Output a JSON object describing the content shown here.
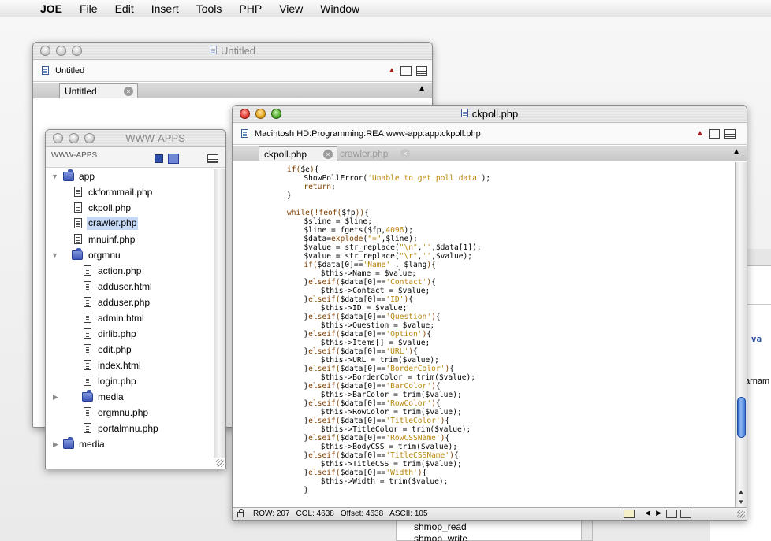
{
  "menubar": {
    "apple_glyph": "",
    "items": [
      "JOE",
      "File",
      "Edit",
      "Insert",
      "Tools",
      "PHP",
      "View",
      "Window"
    ]
  },
  "icons": {
    "apple": "apple-logo-icon",
    "document": "document-icon",
    "share": "share-icon",
    "split": "split-view-icon",
    "info": "info-panel-icon",
    "close_tab": "close-tab-icon",
    "disclosure_open": "disclosure-triangle-open-icon",
    "disclosure_closed": "disclosure-triangle-closed-icon",
    "folder": "folder-icon",
    "file": "file-icon",
    "save": "save-icon",
    "lock": "lock-icon"
  },
  "untitled_window": {
    "title": "Untitled",
    "path": "Untitled",
    "tabs": [
      {
        "label": "Untitled",
        "active": true
      }
    ]
  },
  "wwwapps_window": {
    "title": "WWW-APPS",
    "header": "WWW-APPS",
    "tree": [
      {
        "label": "app",
        "kind": "folder",
        "open": true,
        "depth": 0
      },
      {
        "label": "ckformmail.php",
        "kind": "file",
        "depth": 1
      },
      {
        "label": "ckpoll.php",
        "kind": "file",
        "depth": 1
      },
      {
        "label": "crawler.php",
        "kind": "file",
        "depth": 1,
        "selected": true
      },
      {
        "label": "mnuinf.php",
        "kind": "file",
        "depth": 1
      },
      {
        "label": "orgmnu",
        "kind": "folder",
        "open": true,
        "depth": 1
      },
      {
        "label": "action.php",
        "kind": "file",
        "depth": 2
      },
      {
        "label": "adduser.html",
        "kind": "file",
        "depth": 2
      },
      {
        "label": "adduser.php",
        "kind": "file",
        "depth": 2
      },
      {
        "label": "admin.html",
        "kind": "file",
        "depth": 2
      },
      {
        "label": "dirlib.php",
        "kind": "file",
        "depth": 2
      },
      {
        "label": "edit.php",
        "kind": "file",
        "depth": 2
      },
      {
        "label": "index.html",
        "kind": "file",
        "depth": 2
      },
      {
        "label": "login.php",
        "kind": "file",
        "depth": 2
      },
      {
        "label": "media",
        "kind": "folder",
        "open": false,
        "depth": 2
      },
      {
        "label": "orgmnu.php",
        "kind": "file",
        "depth": 2
      },
      {
        "label": "portalmnu.php",
        "kind": "file",
        "depth": 2
      },
      {
        "label": "media",
        "kind": "folder",
        "open": false,
        "depth": 0
      }
    ]
  },
  "editor_window": {
    "title": "ckpoll.php",
    "path": "Macintosh HD:Programming:REA:www-app:app:ckpoll.php",
    "tabs": [
      {
        "label": "ckpoll.php",
        "active": true
      },
      {
        "label": "crawler.php",
        "active": false
      }
    ],
    "code_lines": [
      [
        8,
        [
          [
            "k",
            "if("
          ],
          [
            "v",
            "$e"
          ],
          [
            "k",
            ")"
          ],
          [
            "n",
            "{"
          ]
        ]
      ],
      [
        12,
        [
          [
            "n",
            "ShowPollError("
          ],
          [
            "s",
            "'Unable to get poll data'"
          ],
          [
            "n",
            ");"
          ]
        ]
      ],
      [
        12,
        [
          [
            "k",
            "return"
          ],
          [
            "n",
            ";"
          ]
        ]
      ],
      [
        8,
        [
          [
            "n",
            "}"
          ]
        ]
      ],
      [
        0,
        []
      ],
      [
        8,
        [
          [
            "k",
            "while(!feof("
          ],
          [
            "v",
            "$fp"
          ],
          [
            "k",
            "))"
          ],
          [
            "n",
            "{"
          ]
        ]
      ],
      [
        12,
        [
          [
            "v",
            "$sline"
          ],
          [
            "n",
            " = "
          ],
          [
            "v",
            "$line"
          ],
          [
            "n",
            ";"
          ]
        ]
      ],
      [
        12,
        [
          [
            "v",
            "$line"
          ],
          [
            "n",
            " = fgets("
          ],
          [
            "v",
            "$fp"
          ],
          [
            "n",
            ","
          ],
          [
            "s",
            "4096"
          ],
          [
            "n",
            ");"
          ]
        ]
      ],
      [
        12,
        [
          [
            "v",
            "$data"
          ],
          [
            "n",
            "="
          ],
          [
            "k",
            "explode"
          ],
          [
            "n",
            "("
          ],
          [
            "s",
            "\"=\""
          ],
          [
            "n",
            ","
          ],
          [
            "v",
            "$line"
          ],
          [
            "n",
            ");"
          ]
        ]
      ],
      [
        12,
        [
          [
            "v",
            "$value"
          ],
          [
            "n",
            " = str_replace("
          ],
          [
            "s",
            "\"\\n\""
          ],
          [
            "n",
            ","
          ],
          [
            "s",
            "''"
          ],
          [
            "n",
            ","
          ],
          [
            "v",
            "$data"
          ],
          [
            "n",
            "[1]);"
          ]
        ]
      ],
      [
        12,
        [
          [
            "v",
            "$value"
          ],
          [
            "n",
            " = str_replace("
          ],
          [
            "s",
            "\"\\r\""
          ],
          [
            "n",
            ","
          ],
          [
            "s",
            "''"
          ],
          [
            "n",
            ","
          ],
          [
            "v",
            "$value"
          ],
          [
            "n",
            ");"
          ]
        ]
      ],
      [
        12,
        [
          [
            "k",
            "if("
          ],
          [
            "v",
            "$data"
          ],
          [
            "n",
            "[0]=="
          ],
          [
            "s",
            "'Name'"
          ],
          [
            "n",
            " . "
          ],
          [
            "v",
            "$lang"
          ],
          [
            "k",
            ")"
          ],
          [
            "n",
            "{"
          ]
        ]
      ],
      [
        16,
        [
          [
            "v",
            "$this"
          ],
          [
            "n",
            "->Name = "
          ],
          [
            "v",
            "$value"
          ],
          [
            "n",
            ";"
          ]
        ]
      ],
      [
        12,
        [
          [
            "n",
            "}"
          ],
          [
            "k",
            "elseif("
          ],
          [
            "v",
            "$data"
          ],
          [
            "n",
            "[0]=="
          ],
          [
            "s",
            "'Contact'"
          ],
          [
            "k",
            ")"
          ],
          [
            "n",
            "{"
          ]
        ]
      ],
      [
        16,
        [
          [
            "v",
            "$this"
          ],
          [
            "n",
            "->Contact = "
          ],
          [
            "v",
            "$value"
          ],
          [
            "n",
            ";"
          ]
        ]
      ],
      [
        12,
        [
          [
            "n",
            "}"
          ],
          [
            "k",
            "elseif("
          ],
          [
            "v",
            "$data"
          ],
          [
            "n",
            "[0]=="
          ],
          [
            "s",
            "'ID'"
          ],
          [
            "k",
            ")"
          ],
          [
            "n",
            "{"
          ]
        ]
      ],
      [
        16,
        [
          [
            "v",
            "$this"
          ],
          [
            "n",
            "->ID = "
          ],
          [
            "v",
            "$value"
          ],
          [
            "n",
            ";"
          ]
        ]
      ],
      [
        12,
        [
          [
            "n",
            "}"
          ],
          [
            "k",
            "elseif("
          ],
          [
            "v",
            "$data"
          ],
          [
            "n",
            "[0]=="
          ],
          [
            "s",
            "'Question'"
          ],
          [
            "k",
            ")"
          ],
          [
            "n",
            "{"
          ]
        ]
      ],
      [
        16,
        [
          [
            "v",
            "$this"
          ],
          [
            "n",
            "->Question = "
          ],
          [
            "v",
            "$value"
          ],
          [
            "n",
            ";"
          ]
        ]
      ],
      [
        12,
        [
          [
            "n",
            "}"
          ],
          [
            "k",
            "elseif("
          ],
          [
            "v",
            "$data"
          ],
          [
            "n",
            "[0]=="
          ],
          [
            "s",
            "'Option'"
          ],
          [
            "k",
            ")"
          ],
          [
            "n",
            "{"
          ]
        ]
      ],
      [
        16,
        [
          [
            "v",
            "$this"
          ],
          [
            "n",
            "->Items[] = "
          ],
          [
            "v",
            "$value"
          ],
          [
            "n",
            ";"
          ]
        ]
      ],
      [
        12,
        [
          [
            "n",
            "}"
          ],
          [
            "k",
            "elseif("
          ],
          [
            "v",
            "$data"
          ],
          [
            "n",
            "[0]=="
          ],
          [
            "s",
            "'URL'"
          ],
          [
            "k",
            ")"
          ],
          [
            "n",
            "{"
          ]
        ]
      ],
      [
        16,
        [
          [
            "v",
            "$this"
          ],
          [
            "n",
            "->URL = trim("
          ],
          [
            "v",
            "$value"
          ],
          [
            "n",
            ");"
          ]
        ]
      ],
      [
        12,
        [
          [
            "n",
            "}"
          ],
          [
            "k",
            "elseif("
          ],
          [
            "v",
            "$data"
          ],
          [
            "n",
            "[0]=="
          ],
          [
            "s",
            "'BorderColor'"
          ],
          [
            "k",
            ")"
          ],
          [
            "n",
            "{"
          ]
        ]
      ],
      [
        16,
        [
          [
            "v",
            "$this"
          ],
          [
            "n",
            "->BorderColor = trim("
          ],
          [
            "v",
            "$value"
          ],
          [
            "n",
            ");"
          ]
        ]
      ],
      [
        12,
        [
          [
            "n",
            "}"
          ],
          [
            "k",
            "elseif("
          ],
          [
            "v",
            "$data"
          ],
          [
            "n",
            "[0]=="
          ],
          [
            "s",
            "'BarColor'"
          ],
          [
            "k",
            ")"
          ],
          [
            "n",
            "{"
          ]
        ]
      ],
      [
        16,
        [
          [
            "v",
            "$this"
          ],
          [
            "n",
            "->BarColor = trim("
          ],
          [
            "v",
            "$value"
          ],
          [
            "n",
            ");"
          ]
        ]
      ],
      [
        12,
        [
          [
            "n",
            "}"
          ],
          [
            "k",
            "elseif("
          ],
          [
            "v",
            "$data"
          ],
          [
            "n",
            "[0]=="
          ],
          [
            "s",
            "'RowColor'"
          ],
          [
            "k",
            ")"
          ],
          [
            "n",
            "{"
          ]
        ]
      ],
      [
        16,
        [
          [
            "v",
            "$this"
          ],
          [
            "n",
            "->RowColor = trim("
          ],
          [
            "v",
            "$value"
          ],
          [
            "n",
            ");"
          ]
        ]
      ],
      [
        12,
        [
          [
            "n",
            "}"
          ],
          [
            "k",
            "elseif("
          ],
          [
            "v",
            "$data"
          ],
          [
            "n",
            "[0]=="
          ],
          [
            "s",
            "'TitleColor'"
          ],
          [
            "k",
            ")"
          ],
          [
            "n",
            "{"
          ]
        ]
      ],
      [
        16,
        [
          [
            "v",
            "$this"
          ],
          [
            "n",
            "->TitleColor = trim("
          ],
          [
            "v",
            "$value"
          ],
          [
            "n",
            ");"
          ]
        ]
      ],
      [
        12,
        [
          [
            "n",
            "}"
          ],
          [
            "k",
            "elseif("
          ],
          [
            "v",
            "$data"
          ],
          [
            "n",
            "[0]=="
          ],
          [
            "s",
            "'RowCSSName'"
          ],
          [
            "k",
            ")"
          ],
          [
            "n",
            "{"
          ]
        ]
      ],
      [
        16,
        [
          [
            "v",
            "$this"
          ],
          [
            "n",
            "->BodyCSS = trim("
          ],
          [
            "v",
            "$value"
          ],
          [
            "n",
            ");"
          ]
        ]
      ],
      [
        12,
        [
          [
            "n",
            "}"
          ],
          [
            "k",
            "elseif("
          ],
          [
            "v",
            "$data"
          ],
          [
            "n",
            "[0]=="
          ],
          [
            "s",
            "'TitleCSSName'"
          ],
          [
            "k",
            ")"
          ],
          [
            "n",
            "{"
          ]
        ]
      ],
      [
        16,
        [
          [
            "v",
            "$this"
          ],
          [
            "n",
            "->TitleCSS = trim("
          ],
          [
            "v",
            "$value"
          ],
          [
            "n",
            ");"
          ]
        ]
      ],
      [
        12,
        [
          [
            "n",
            "}"
          ],
          [
            "k",
            "elseif("
          ],
          [
            "v",
            "$data"
          ],
          [
            "n",
            "[0]=="
          ],
          [
            "s",
            "'Width'"
          ],
          [
            "k",
            ")"
          ],
          [
            "n",
            "{"
          ]
        ]
      ],
      [
        16,
        [
          [
            "v",
            "$this"
          ],
          [
            "n",
            "->Width = trim("
          ],
          [
            "v",
            "$value"
          ],
          [
            "n",
            ");"
          ]
        ]
      ],
      [
        12,
        [
          [
            "n",
            "}"
          ]
        ]
      ]
    ],
    "status": {
      "row": "ROW: 207",
      "col": "COL: 4638",
      "offset": "Offset: 4638",
      "ascii": "ASCII: 105"
    }
  },
  "background_fragments": {
    "right_text_1": "ng va",
    "right_text_2": "arnam",
    "list_1": "shmop_read",
    "list_2": "shmop_write"
  },
  "colors": {
    "keyword": "#804000",
    "string": "#b8860b",
    "selection": "#c5d9f6",
    "scroll_thumb": "#3f7ad9"
  }
}
